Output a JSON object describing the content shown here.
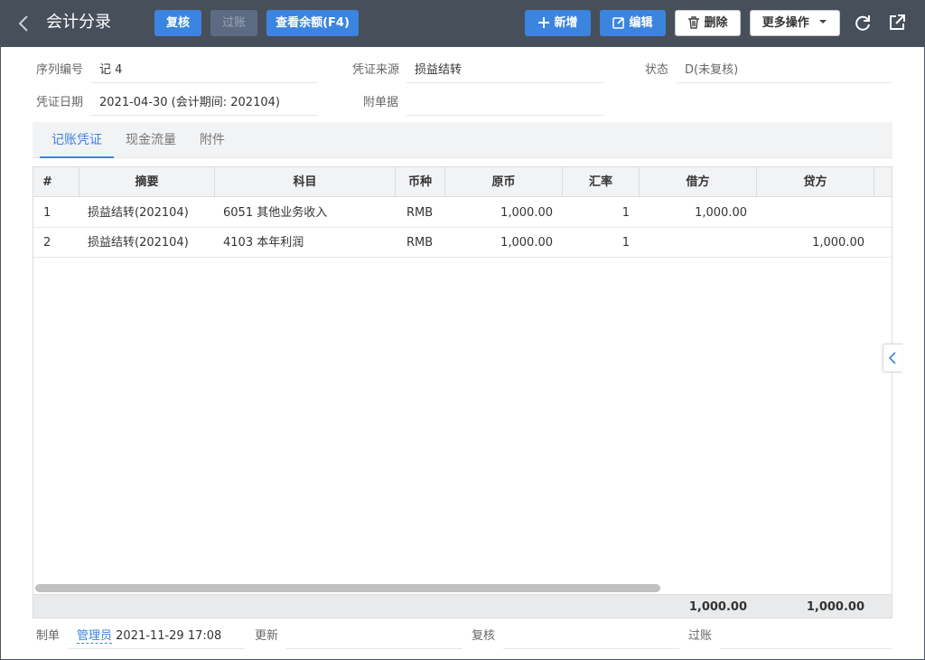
{
  "header": {
    "title": "会计分录",
    "buttons": {
      "review": "复核",
      "post": "过账",
      "check_balance": "查看余额(F4)",
      "add": "新增",
      "edit": "编辑",
      "delete": "删除",
      "more": "更多操作"
    }
  },
  "form": {
    "serial_label": "序列编号",
    "serial_value": "记 4",
    "source_label": "凭证来源",
    "source_value": "损益结转",
    "status_label": "状态",
    "status_value": "D(未复核)",
    "date_label": "凭证日期",
    "date_value": "2021-04-30  (会计期间: 202104)",
    "attachment_label": "附单据",
    "attachment_value": ""
  },
  "tabs": [
    "记账凭证",
    "现金流量",
    "附件"
  ],
  "grid": {
    "columns": [
      "#",
      "摘要",
      "科目",
      "币种",
      "原币",
      "汇率",
      "借方",
      "贷方"
    ],
    "rows": [
      [
        "1",
        "损益结转(202104)",
        "6051 其他业务收入",
        "RMB",
        "1,000.00",
        "1",
        "1,000.00",
        ""
      ],
      [
        "2",
        "损益结转(202104)",
        "4103 本年利润",
        "RMB",
        "1,000.00",
        "1",
        "",
        "1,000.00"
      ]
    ],
    "totals": {
      "debit": "1,000.00",
      "credit": "1,000.00"
    }
  },
  "bottom": {
    "maker_label": "制单",
    "maker_user": "管理员",
    "maker_time": "2021-11-29 17:08",
    "update_label": "更新",
    "review_label": "复核",
    "post_label": "过账"
  },
  "colors": {
    "topbar": "#474f5b",
    "primary": "#3b84e0",
    "disabled": "#5d6b82"
  }
}
